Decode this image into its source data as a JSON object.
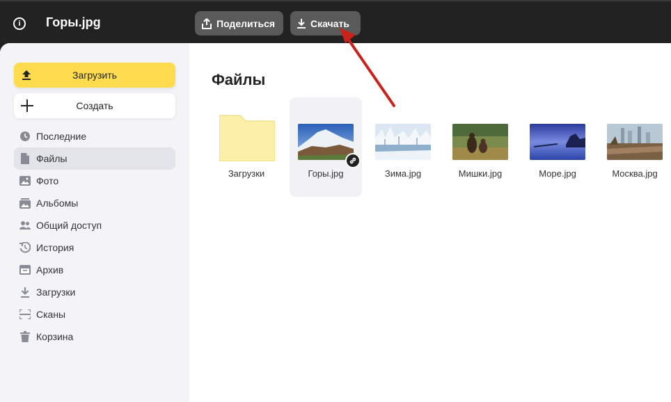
{
  "header": {
    "filename": "Горы.jpg",
    "share_label": "Поделиться",
    "download_label": "Скачать",
    "info_icon": "i"
  },
  "sidebar": {
    "upload_label": "Загрузить",
    "create_label": "Создать",
    "items": [
      {
        "label": "Последние",
        "icon": "clock-icon"
      },
      {
        "label": "Файлы",
        "icon": "file-icon",
        "active": true
      },
      {
        "label": "Фото",
        "icon": "photo-icon"
      },
      {
        "label": "Альбомы",
        "icon": "albums-icon"
      },
      {
        "label": "Общий доступ",
        "icon": "people-icon"
      },
      {
        "label": "История",
        "icon": "history-icon"
      },
      {
        "label": "Архив",
        "icon": "archive-icon"
      },
      {
        "label": "Загрузки",
        "icon": "download-icon"
      },
      {
        "label": "Сканы",
        "icon": "scan-icon"
      },
      {
        "label": "Корзина",
        "icon": "trash-icon"
      }
    ]
  },
  "main": {
    "title": "Файлы",
    "files": [
      {
        "name": "Загрузки",
        "type": "folder"
      },
      {
        "name": "Горы.jpg",
        "type": "image",
        "selected": true,
        "shared": true
      },
      {
        "name": "Зима.jpg",
        "type": "image"
      },
      {
        "name": "Мишки.jpg",
        "type": "image"
      },
      {
        "name": "Море.jpg",
        "type": "image"
      },
      {
        "name": "Москва.jpg",
        "type": "image"
      }
    ]
  },
  "colors": {
    "accent_yellow": "#fedc4d",
    "annotation_arrow": "#c8221b",
    "topbar": "#222222"
  }
}
